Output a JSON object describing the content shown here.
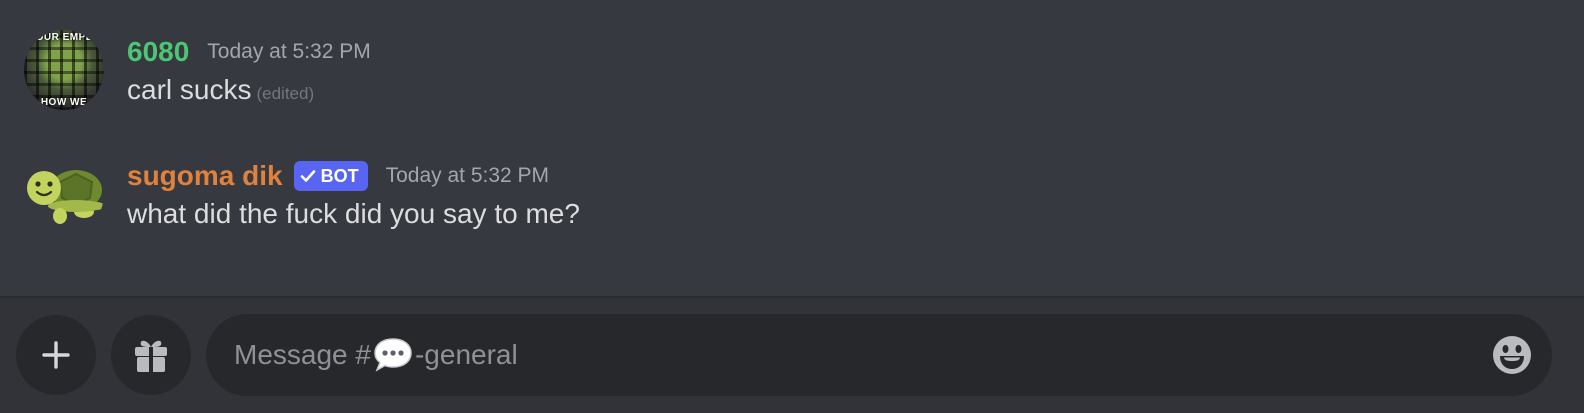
{
  "messages": [
    {
      "username": "6080",
      "username_color": "#4dc574",
      "timestamp": "Today at 5:32 PM",
      "content": "carl sucks",
      "edited_label": "(edited)",
      "avatar_icon": "meme-photo-avatar",
      "avatar_text_top": "OUR EMPL",
      "avatar_text_bottom": "HOW WE"
    },
    {
      "username": "sugoma dik",
      "username_color": "#e0823d",
      "bot_tag": "BOT",
      "bot_tag_color": "#5865f2",
      "timestamp": "Today at 5:32 PM",
      "content": "what did the fuck did you say to me?",
      "avatar_icon": "turtle-icon"
    }
  ],
  "composer": {
    "placeholder_prefix": "Message #",
    "channel_icon": "speech-bubble-icon",
    "placeholder_suffix": "-general",
    "buttons": [
      "plus-icon",
      "gift-icon",
      "emoji-icon"
    ]
  }
}
